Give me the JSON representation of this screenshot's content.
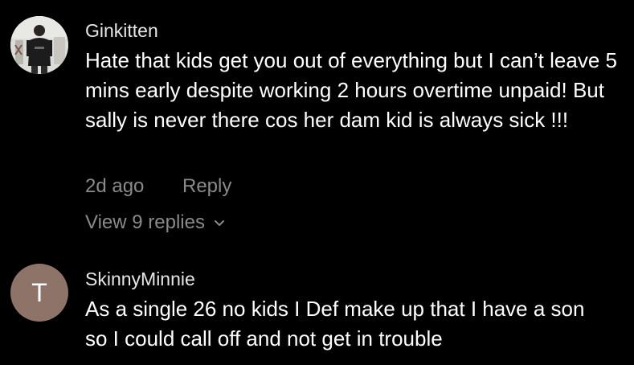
{
  "comments": [
    {
      "username": "Ginkitten",
      "text": "Hate that kids get you out of everything but I can’t leave 5 mins early despite working 2 hours overtime unpaid! But sally is never there cos her dam kid is always sick !!!",
      "time": "2d ago",
      "reply_label": "Reply",
      "view_replies_label": "View 9 replies",
      "avatar_icon": "user-photo"
    },
    {
      "username": "SkinnyMinnie",
      "text": "As a single 26 no kids I Def make up that I have a son so I could call off and not get in trouble",
      "avatar_letter": "T",
      "avatar_color": "#8e7368"
    }
  ],
  "colors": {
    "background": "#000000",
    "text": "#ffffff",
    "muted": "#8a8a8a"
  }
}
